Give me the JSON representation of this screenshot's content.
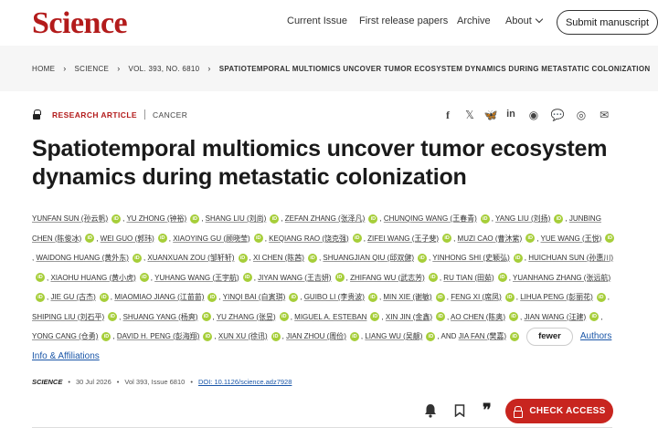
{
  "brand": {
    "logo": "Science",
    "accent": "#b31b1b"
  },
  "nav": {
    "current_issue": "Current Issue",
    "first_release": "First release papers",
    "archive": "Archive",
    "about": "About",
    "submit": "Submit manuscript"
  },
  "breadcrumb": {
    "home": "HOME",
    "science": "SCIENCE",
    "volume": "VOL. 393, NO. 6810",
    "current": "SPATIOTEMPORAL MULTIOMICS UNCOVER TUMOR ECOSYSTEM DYNAMICS DURING METASTATIC COLONIZATION"
  },
  "article": {
    "type": "RESEARCH ARTICLE",
    "subject": "CANCER",
    "title": "Spatiotemporal multiomics uncover tumor ecosystem dynamics during metastatic colonization"
  },
  "share_icons": [
    "facebook-icon",
    "x-icon",
    "bluesky-icon",
    "linkedin-icon",
    "reddit-icon",
    "wechat-icon",
    "whatsapp-icon",
    "email-icon"
  ],
  "authors": [
    "YUNFAN SUN (孙云帆)",
    "YU ZHONG (钟裕)",
    "SHANG LIU (刘尚)",
    "ZEFAN ZHANG (张泽凡)",
    "CHUNQING WANG (王春青)",
    "YANG LIU (刘扬)",
    "JUNBING CHEN (陈俊冰)",
    "WEI GUO (郭玮)",
    "XIAOYING GU (顾晓莹)",
    "KEQIANG RAO (饶克强)",
    "ZIFEI WANG (王子斐)",
    "MUZI CAO (曹沐紫)",
    "YUE WANG (王悦)",
    "WAIDONG HUANG (黄外东)",
    "XUANXUAN ZOU (邹轩轩)",
    "XI CHEN (陈茜)",
    "SHUANGJIAN QIU (邱双健)",
    "YINHONG SHI (史颖弘)",
    "HUICHUAN SUN (孙惠川)",
    "XIAOHU HUANG (黄小虎)",
    "YUHANG WANG (王宇航)",
    "JIYAN WANG (王吉妍)",
    "ZHIFANG WU (武志芳)",
    "RU TIAN (田茹)",
    "YUANHANG ZHANG (张远航)",
    "JIE GU (古杰)",
    "MIAOMIAO JIANG (江苗苗)",
    "YINQI BAI (白寅琪)",
    "GUIBO LI (李贵波)",
    "MIN XIE (谢敏)",
    "FENG XI (席凤)",
    "LIHUA PENG (彭丽花)",
    "SHIPING LIU (刘石平)",
    "SHUANG YANG (杨爽)",
    "YU ZHANG (张昱)",
    "MIGUEL A. ESTEBAN",
    "XIN JIN (金鑫)",
    "AO CHEN (陈奥)",
    "JIAN WANG (汪建)",
    "YONG CANG (仓勇)",
    "DAVID H. PENG (彭海翔)",
    "XUN XU (徐讯)",
    "JIAN ZHOU (周俭)",
    "LIANG WU (吴靓)",
    "JIA FAN (樊嘉)"
  ],
  "authors_and": "AND",
  "fewer_label": "fewer",
  "affil_label": "Authors Info & Affiliations",
  "citation": {
    "journal": "SCIENCE",
    "date": "30 Jul 2026",
    "volume": "Vol 393, Issue 6810",
    "doi": "DOI: 10.1126/science.adz7928"
  },
  "actions": {
    "check_access": "CHECK ACCESS",
    "quote": "❞"
  },
  "colors": {
    "check_access_bg": "#c8251f",
    "link": "#1a56a8",
    "orcid": "#a6ce39"
  }
}
